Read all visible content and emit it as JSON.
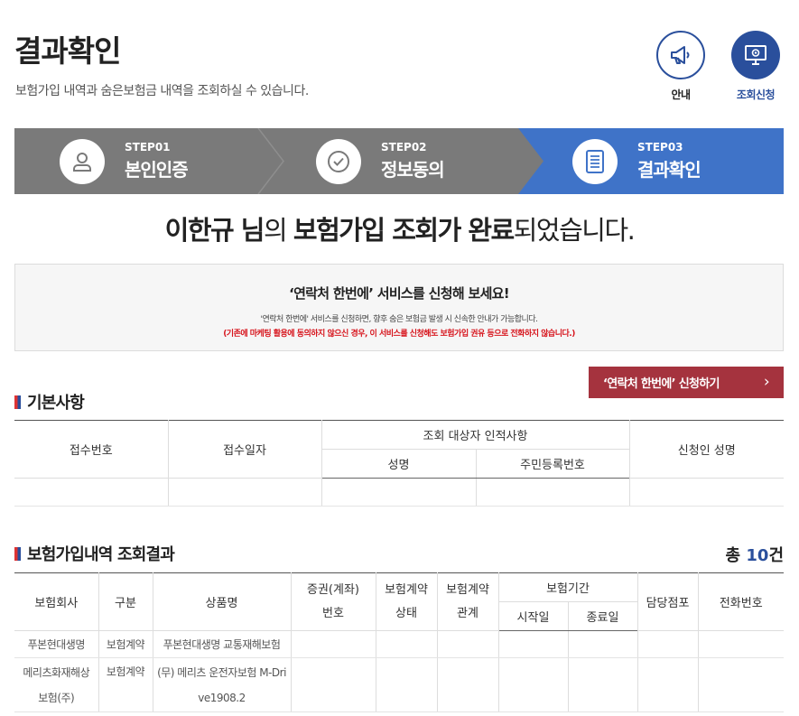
{
  "header": {
    "title": "결과확인",
    "subtitle": "보험가입 내역과 숨은보험금 내역을 조회하실 수 있습니다."
  },
  "top_buttons": {
    "guide": {
      "label": "안내",
      "icon": "megaphone-icon"
    },
    "inquiry": {
      "label": "조회신청",
      "icon": "monitor-icon"
    }
  },
  "steps": [
    {
      "num": "STEP01",
      "name": "본인인증",
      "icon": "person-icon"
    },
    {
      "num": "STEP02",
      "name": "정보동의",
      "icon": "check-circle-icon"
    },
    {
      "num": "STEP03",
      "name": "결과확인",
      "icon": "document-icon"
    }
  ],
  "done_message": {
    "name": "이한규",
    "nim": " 님",
    "particle": "의 ",
    "highlight1": "보험가입 조회가 완료",
    "tail": "되었습니다."
  },
  "notice": {
    "heading": "‘연락처 한번에’ 서비스를 신청해 보세요!",
    "line1": "'연락처 한번에' 서비스를 신청하면, 향후 숨은 보험금 발생 시 신속한 안내가 가능합니다.",
    "line2": "(기존에 마케팅 활용에 동의하지 않으신 경우, 이 서비스를 신청해도 보험가입 권유 등으로 전화하지 않습니다.)"
  },
  "apply_button": {
    "label": "‘연락처 한번에’ 신청하기",
    "arrow": "›"
  },
  "basic_section": {
    "title": "기본사항",
    "headers": {
      "receipt_no": "접수번호",
      "receipt_date": "접수일자",
      "subject_info": "조회 대상자 인적사항",
      "name": "성명",
      "rrn": "주민등록번호",
      "applicant_name": "신청인 성명"
    }
  },
  "result_section": {
    "title": "보험가입내역 조회결과",
    "total_prefix": "총 ",
    "total_count": "10",
    "total_suffix": "건",
    "headers": {
      "company": "보험회사",
      "category": "구분",
      "product": "상품명",
      "policy_no_1": "증권(계좌)",
      "policy_no_2": "번호",
      "status_1": "보험계약",
      "status_2": "상태",
      "relation_1": "보험계약",
      "relation_2": "관계",
      "period": "보험기간",
      "start": "시작일",
      "end": "종료일",
      "branch": "담당점포",
      "phone": "전화번호"
    },
    "rows": [
      {
        "company": "푸본현대생명",
        "category": "보험계약",
        "product": "푸본현대생명 교통재해보험"
      },
      {
        "company_1": "메리츠화재해상",
        "company_2": "보험(주)",
        "category": "보험계약",
        "product_1": "(무) 메리츠 운전자보험 M-Dri",
        "product_2": "ve1908.2"
      }
    ]
  },
  "colors": {
    "primary_blue": "#2a4f9c",
    "step_active": "#3f73c8",
    "step_inactive": "#7a7a7a",
    "apply_red": "#a5333e",
    "notice_red": "#d7141c"
  }
}
